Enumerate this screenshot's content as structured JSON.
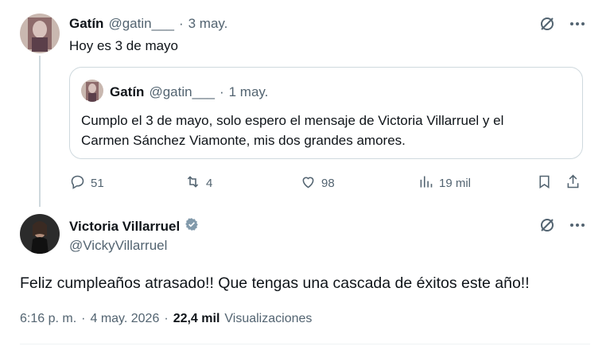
{
  "tweet1": {
    "name": "Gatín",
    "handle": "@gatin___",
    "dot": "·",
    "date": "3 may.",
    "text": "Hoy es 3 de mayo"
  },
  "quote": {
    "name": "Gatín",
    "handle": "@gatin___",
    "dot": "·",
    "date": "1 may.",
    "text_line1": "Cumplo el 3 de mayo, solo espero el mensaje de Victoria Villarruel y el",
    "text_line2": "Carmen Sánchez Viamonte, mis dos  grandes amores."
  },
  "actions": {
    "replies": "51",
    "reposts": "4",
    "likes": "98",
    "views": "19 mil"
  },
  "tweet2": {
    "name": "Victoria Villarruel",
    "handle": "@VickyVillarruel",
    "text": "Feliz cumpleaños atrasado!! Que tengas una cascada de éxitos este año!!",
    "time": "6:16 p. m.",
    "dot": "·",
    "date": "4 may. 2026",
    "views_count": "22,4 mil",
    "views_label": "Visualizaciones"
  },
  "icons": {
    "grok": "grok-icon",
    "more": "more-icon",
    "verified": "verified-badge-icon",
    "reply": "reply-icon",
    "repost": "repost-icon",
    "like": "like-icon",
    "views": "views-icon",
    "bookmark": "bookmark-icon",
    "share": "share-icon"
  },
  "colors": {
    "text": "#0f1419",
    "secondary": "#536471",
    "border": "#cfd9de",
    "verified": "#829aab"
  }
}
